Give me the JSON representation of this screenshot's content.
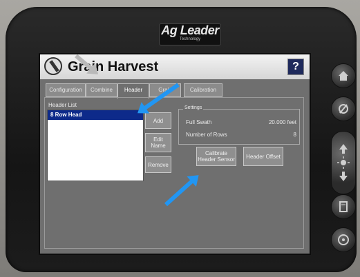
{
  "brand": {
    "name": "Ag Leader",
    "tagline": "Technology"
  },
  "window": {
    "title": "Grain Harvest",
    "help_label": "?"
  },
  "tabs": [
    "Configuration",
    "Combine",
    "Header",
    "Grain",
    "Calibration"
  ],
  "active_tab": "Header",
  "header_list": {
    "label": "Header List",
    "items": [
      "8 Row Head"
    ],
    "selected": "8 Row Head"
  },
  "buttons": {
    "add": "Add",
    "edit_name": "Edit Name",
    "remove": "Remove",
    "calibrate_header_sensor": "Calibrate Header Sensor",
    "header_offset": "Header Offset"
  },
  "settings": {
    "legend": "Settings",
    "rows": [
      {
        "label": "Full Swath",
        "value": "20.000 feet"
      },
      {
        "label": "Number of Rows",
        "value": "8"
      }
    ]
  },
  "side_buttons": [
    "home-icon",
    "wrench-icon",
    "brightness-icon",
    "manual-icon",
    "steering-icon"
  ],
  "colors": {
    "selection": "#0d2a8a",
    "annotation_arrow": "#2196f3",
    "help_button": "#1f2a5c"
  }
}
